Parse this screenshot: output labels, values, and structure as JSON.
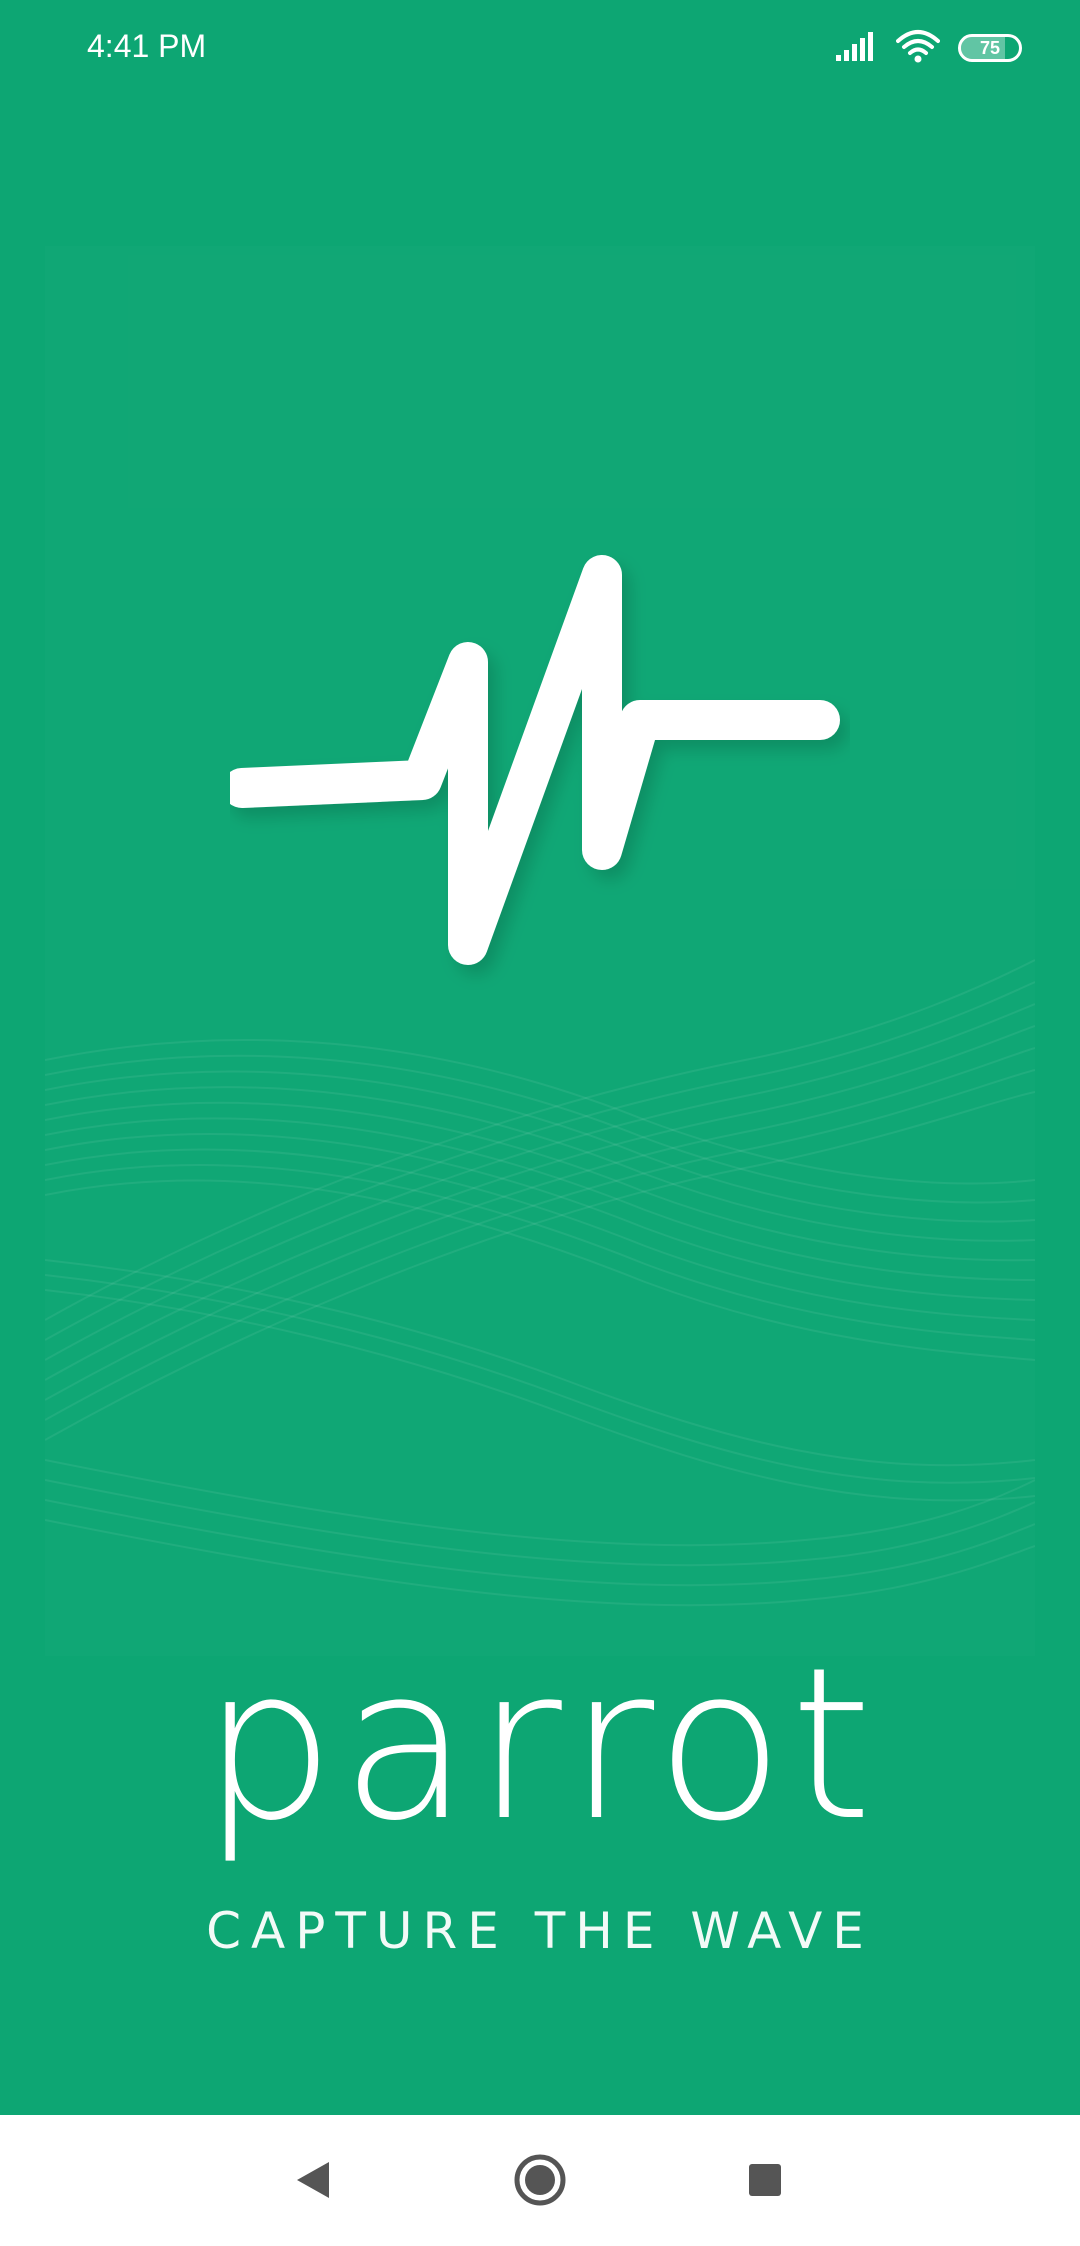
{
  "status_bar": {
    "time": "4:41 PM",
    "battery_level": "75",
    "icons": [
      "signal-icon",
      "wifi-icon",
      "battery-icon"
    ]
  },
  "splash": {
    "logo_icon": "heartbeat-wave-icon",
    "app_name": "parrot",
    "tagline": "CAPTURE THE WAVE"
  },
  "navigation_bar": {
    "icons": [
      "back-icon",
      "home-icon",
      "recents-icon"
    ]
  },
  "colors": {
    "brand_green": "#0DA673",
    "text": "#FFFFFF",
    "nav_background": "#FFFFFF",
    "nav_icons": "#555555"
  }
}
